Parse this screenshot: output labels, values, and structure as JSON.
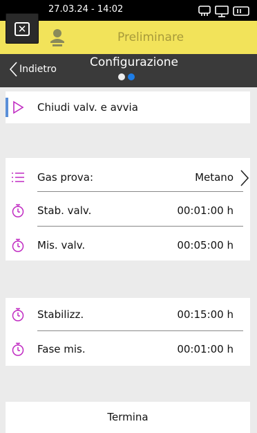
{
  "status": {
    "datetime": "27.03.24 - 14:02"
  },
  "header": {
    "mode": "Preliminare"
  },
  "nav": {
    "back_label": "Indietro",
    "title": "Configurazione"
  },
  "action": {
    "label": "Chiudi valv. e avvia"
  },
  "group1": [
    {
      "label": "Gas prova:",
      "value": "Metano",
      "icon": "list-icon"
    },
    {
      "label": "Stab. valv.",
      "value": "00:01:00 h",
      "icon": "timer-icon"
    },
    {
      "label": "Mis. valv.",
      "value": "00:05:00 h",
      "icon": "timer-icon"
    }
  ],
  "group2": [
    {
      "label": "Stabilizz.",
      "value": "00:15:00 h",
      "icon": "timer-icon"
    },
    {
      "label": "Fase mis.",
      "value": "00:01:00 h",
      "icon": "timer-icon"
    }
  ],
  "footer": {
    "button_label": "Termina"
  },
  "colors": {
    "accent": "#c02ac2",
    "header": "#f2e35a",
    "nav": "#3a3a3a",
    "page_dot_active": "#1e7ee8"
  }
}
